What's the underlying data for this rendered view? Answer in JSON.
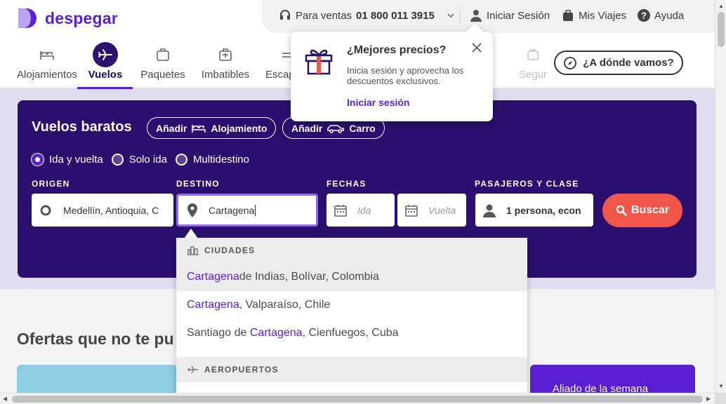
{
  "brand": {
    "name": "despegar",
    "color": "#5a1fd1"
  },
  "topbar": {
    "sales_label": "Para ventas",
    "sales_phone": "01 800 011 3915",
    "login": "Iniciar Sesión",
    "trips": "Mis Viajes",
    "help": "Ayuda"
  },
  "nav": {
    "items": [
      {
        "label": "Alojamientos",
        "icon": "bed-icon"
      },
      {
        "label": "Vuelos",
        "icon": "plane-icon",
        "active": true
      },
      {
        "label": "Paquetes",
        "icon": "suitcase-icon"
      },
      {
        "label": "Imbatibles",
        "icon": "luggage-icon"
      },
      {
        "label": "Escap",
        "icon": "escapadas-icon"
      },
      {
        "label": "Segur",
        "icon": "insurance-icon"
      }
    ],
    "where_button": "¿A dónde vamos?"
  },
  "search": {
    "title": "Vuelos baratos",
    "add_label": "Añadir",
    "chip_hotel": "Alojamiento",
    "chip_car": "Carro",
    "trip_types": [
      "Ida y vuelta",
      "Solo ida",
      "Multidestino"
    ],
    "selected_trip_type": "Ida y vuelta",
    "origin_label": "ORIGEN",
    "origin_value": "Medellín, Antioquia, C",
    "destination_label": "DESTINO",
    "destination_value": "Cartagena",
    "dates_label": "FECHAS",
    "depart_placeholder": "Ida",
    "return_placeholder": "Vuelta",
    "passengers_label": "PASAJEROS Y CLASE",
    "passengers_value": "1 persona, econ",
    "search_button": "Buscar"
  },
  "dropdown": {
    "cities_header": "CIUDADES",
    "cities": [
      {
        "match": "Cartagena",
        "rest": " de Indias, Bolívar, Colombia"
      },
      {
        "match": "Cartagena",
        "rest": ", Valparaíso, Chile"
      },
      {
        "pre": "Santiago de ",
        "match": "Cartagena",
        "rest": ", Cienfuegos, Cuba"
      }
    ],
    "airports_header": "AEROPUERTOS"
  },
  "popover": {
    "title": "¿Mejores precios?",
    "text": "Inicia sesión y aprovecha los descuentos exclusivos.",
    "link": "Iniciar sesión"
  },
  "offers": {
    "title": "Ofertas que no te pu",
    "card_right": "Aliado de la semana"
  }
}
